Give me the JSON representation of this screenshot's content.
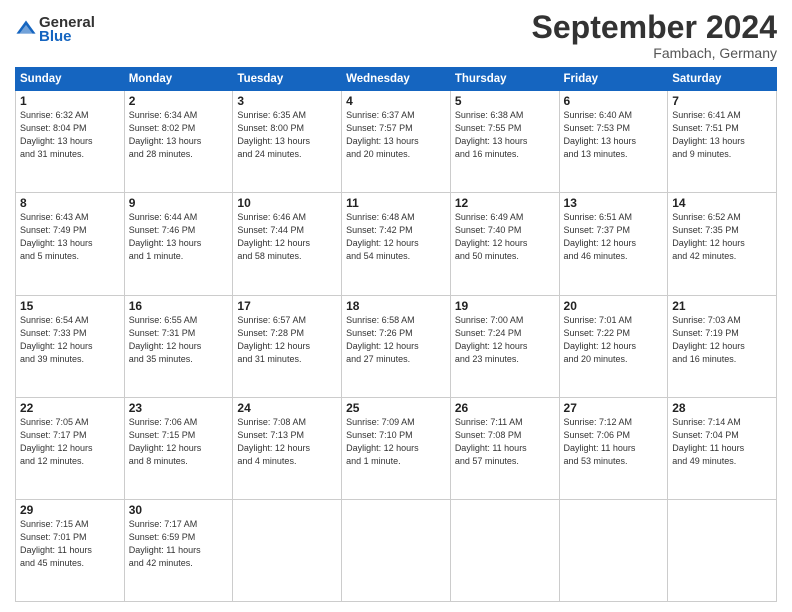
{
  "header": {
    "logo_general": "General",
    "logo_blue": "Blue",
    "month": "September 2024",
    "location": "Fambach, Germany"
  },
  "weekdays": [
    "Sunday",
    "Monday",
    "Tuesday",
    "Wednesday",
    "Thursday",
    "Friday",
    "Saturday"
  ],
  "weeks": [
    [
      {
        "day": "1",
        "info": "Sunrise: 6:32 AM\nSunset: 8:04 PM\nDaylight: 13 hours\nand 31 minutes."
      },
      {
        "day": "2",
        "info": "Sunrise: 6:34 AM\nSunset: 8:02 PM\nDaylight: 13 hours\nand 28 minutes."
      },
      {
        "day": "3",
        "info": "Sunrise: 6:35 AM\nSunset: 8:00 PM\nDaylight: 13 hours\nand 24 minutes."
      },
      {
        "day": "4",
        "info": "Sunrise: 6:37 AM\nSunset: 7:57 PM\nDaylight: 13 hours\nand 20 minutes."
      },
      {
        "day": "5",
        "info": "Sunrise: 6:38 AM\nSunset: 7:55 PM\nDaylight: 13 hours\nand 16 minutes."
      },
      {
        "day": "6",
        "info": "Sunrise: 6:40 AM\nSunset: 7:53 PM\nDaylight: 13 hours\nand 13 minutes."
      },
      {
        "day": "7",
        "info": "Sunrise: 6:41 AM\nSunset: 7:51 PM\nDaylight: 13 hours\nand 9 minutes."
      }
    ],
    [
      {
        "day": "8",
        "info": "Sunrise: 6:43 AM\nSunset: 7:49 PM\nDaylight: 13 hours\nand 5 minutes."
      },
      {
        "day": "9",
        "info": "Sunrise: 6:44 AM\nSunset: 7:46 PM\nDaylight: 13 hours\nand 1 minute."
      },
      {
        "day": "10",
        "info": "Sunrise: 6:46 AM\nSunset: 7:44 PM\nDaylight: 12 hours\nand 58 minutes."
      },
      {
        "day": "11",
        "info": "Sunrise: 6:48 AM\nSunset: 7:42 PM\nDaylight: 12 hours\nand 54 minutes."
      },
      {
        "day": "12",
        "info": "Sunrise: 6:49 AM\nSunset: 7:40 PM\nDaylight: 12 hours\nand 50 minutes."
      },
      {
        "day": "13",
        "info": "Sunrise: 6:51 AM\nSunset: 7:37 PM\nDaylight: 12 hours\nand 46 minutes."
      },
      {
        "day": "14",
        "info": "Sunrise: 6:52 AM\nSunset: 7:35 PM\nDaylight: 12 hours\nand 42 minutes."
      }
    ],
    [
      {
        "day": "15",
        "info": "Sunrise: 6:54 AM\nSunset: 7:33 PM\nDaylight: 12 hours\nand 39 minutes."
      },
      {
        "day": "16",
        "info": "Sunrise: 6:55 AM\nSunset: 7:31 PM\nDaylight: 12 hours\nand 35 minutes."
      },
      {
        "day": "17",
        "info": "Sunrise: 6:57 AM\nSunset: 7:28 PM\nDaylight: 12 hours\nand 31 minutes."
      },
      {
        "day": "18",
        "info": "Sunrise: 6:58 AM\nSunset: 7:26 PM\nDaylight: 12 hours\nand 27 minutes."
      },
      {
        "day": "19",
        "info": "Sunrise: 7:00 AM\nSunset: 7:24 PM\nDaylight: 12 hours\nand 23 minutes."
      },
      {
        "day": "20",
        "info": "Sunrise: 7:01 AM\nSunset: 7:22 PM\nDaylight: 12 hours\nand 20 minutes."
      },
      {
        "day": "21",
        "info": "Sunrise: 7:03 AM\nSunset: 7:19 PM\nDaylight: 12 hours\nand 16 minutes."
      }
    ],
    [
      {
        "day": "22",
        "info": "Sunrise: 7:05 AM\nSunset: 7:17 PM\nDaylight: 12 hours\nand 12 minutes."
      },
      {
        "day": "23",
        "info": "Sunrise: 7:06 AM\nSunset: 7:15 PM\nDaylight: 12 hours\nand 8 minutes."
      },
      {
        "day": "24",
        "info": "Sunrise: 7:08 AM\nSunset: 7:13 PM\nDaylight: 12 hours\nand 4 minutes."
      },
      {
        "day": "25",
        "info": "Sunrise: 7:09 AM\nSunset: 7:10 PM\nDaylight: 12 hours\nand 1 minute."
      },
      {
        "day": "26",
        "info": "Sunrise: 7:11 AM\nSunset: 7:08 PM\nDaylight: 11 hours\nand 57 minutes."
      },
      {
        "day": "27",
        "info": "Sunrise: 7:12 AM\nSunset: 7:06 PM\nDaylight: 11 hours\nand 53 minutes."
      },
      {
        "day": "28",
        "info": "Sunrise: 7:14 AM\nSunset: 7:04 PM\nDaylight: 11 hours\nand 49 minutes."
      }
    ],
    [
      {
        "day": "29",
        "info": "Sunrise: 7:15 AM\nSunset: 7:01 PM\nDaylight: 11 hours\nand 45 minutes."
      },
      {
        "day": "30",
        "info": "Sunrise: 7:17 AM\nSunset: 6:59 PM\nDaylight: 11 hours\nand 42 minutes."
      },
      {
        "day": "",
        "info": ""
      },
      {
        "day": "",
        "info": ""
      },
      {
        "day": "",
        "info": ""
      },
      {
        "day": "",
        "info": ""
      },
      {
        "day": "",
        "info": ""
      }
    ]
  ]
}
